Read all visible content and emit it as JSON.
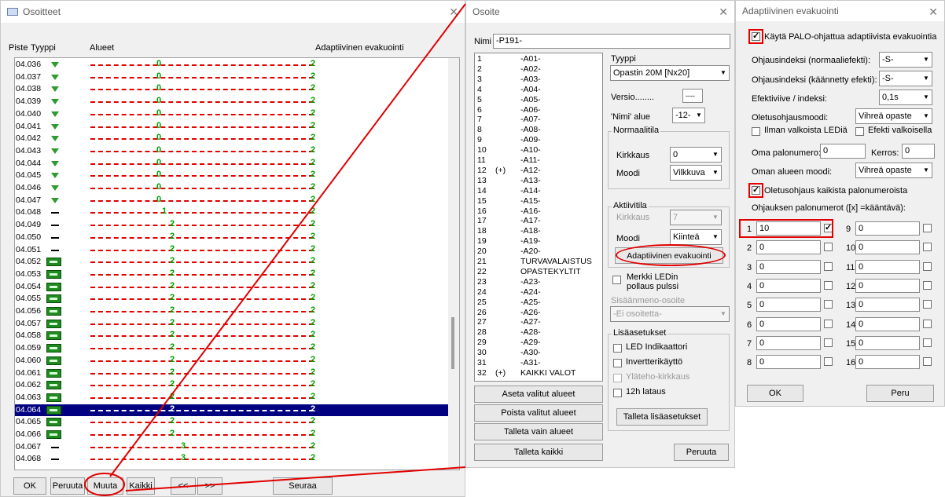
{
  "window1": {
    "title": "Osoitteet",
    "headers": {
      "piste": "Piste",
      "tyyppi": "Tyyppi",
      "alueet": "Alueet",
      "adaptive": "Adaptiivinen evakuointi"
    },
    "rows": [
      {
        "piste": "04.036",
        "type": "tri",
        "v1": "0",
        "v2": "2"
      },
      {
        "piste": "04.037",
        "type": "tri",
        "v1": "0",
        "v2": "2"
      },
      {
        "piste": "04.038",
        "type": "tri",
        "v1": "0",
        "v2": "2"
      },
      {
        "piste": "04.039",
        "type": "tri",
        "v1": "0",
        "v2": "2"
      },
      {
        "piste": "04.040",
        "type": "tri",
        "v1": "0",
        "v2": "2"
      },
      {
        "piste": "04.041",
        "type": "tri",
        "v1": "0",
        "v2": "2"
      },
      {
        "piste": "04.042",
        "type": "tri",
        "v1": "0",
        "v2": "2"
      },
      {
        "piste": "04.043",
        "type": "tri",
        "v1": "0",
        "v2": "2"
      },
      {
        "piste": "04.044",
        "type": "tri",
        "v1": "0",
        "v2": "2"
      },
      {
        "piste": "04.045",
        "type": "tri",
        "v1": "0",
        "v2": "2"
      },
      {
        "piste": "04.046",
        "type": "tri",
        "v1": "0",
        "v2": "2"
      },
      {
        "piste": "04.047",
        "type": "tri",
        "v1": "0",
        "v2": "2"
      },
      {
        "piste": "04.048",
        "type": "dash",
        "v1": "1",
        "v2": "2"
      },
      {
        "piste": "04.049",
        "type": "dash",
        "v1": "2",
        "v2": "2"
      },
      {
        "piste": "04.050",
        "type": "dash",
        "v1": "2",
        "v2": "2"
      },
      {
        "piste": "04.051",
        "type": "dash",
        "v1": "2",
        "v2": "2"
      },
      {
        "piste": "04.052",
        "type": "sign",
        "v1": "2",
        "v2": "2"
      },
      {
        "piste": "04.053",
        "type": "sign",
        "v1": "2",
        "v2": "2"
      },
      {
        "piste": "04.054",
        "type": "sign",
        "v1": "2",
        "v2": "2"
      },
      {
        "piste": "04.055",
        "type": "sign",
        "v1": "2",
        "v2": "2"
      },
      {
        "piste": "04.056",
        "type": "sign",
        "v1": "2",
        "v2": "2"
      },
      {
        "piste": "04.057",
        "type": "sign",
        "v1": "2",
        "v2": "2"
      },
      {
        "piste": "04.058",
        "type": "sign",
        "v1": "2",
        "v2": "2"
      },
      {
        "piste": "04.059",
        "type": "sign",
        "v1": "2",
        "v2": "2"
      },
      {
        "piste": "04.060",
        "type": "sign",
        "v1": "2",
        "v2": "2"
      },
      {
        "piste": "04.061",
        "type": "sign",
        "v1": "2",
        "v2": "2"
      },
      {
        "piste": "04.062",
        "type": "sign",
        "v1": "2",
        "v2": "2"
      },
      {
        "piste": "04.063",
        "type": "sign",
        "v1": "2",
        "v2": "2"
      },
      {
        "piste": "04.064",
        "type": "sign",
        "v1": "2",
        "v2": "2",
        "selected": true
      },
      {
        "piste": "04.065",
        "type": "sign",
        "v1": "2",
        "v2": "2"
      },
      {
        "piste": "04.066",
        "type": "sign",
        "v1": "2",
        "v2": "2"
      },
      {
        "piste": "04.067",
        "type": "dash",
        "v1": "3",
        "v2": "2"
      },
      {
        "piste": "04.068",
        "type": "dash",
        "v1": "3",
        "v2": "2"
      }
    ],
    "buttons": {
      "ok": "OK",
      "peruuta": "Peruuta",
      "muuta": "Muuta",
      "kaikki": "Kaikki",
      "prev": "<<",
      "next": ">>",
      "seuraa": "Seuraa"
    }
  },
  "window2": {
    "title": "Osoite",
    "nimi_label": "Nimi",
    "nimi_value": "-P191-",
    "zones": [
      {
        "n": "1",
        "f": "",
        "name": "-A01-"
      },
      {
        "n": "2",
        "f": "",
        "name": "-A02-"
      },
      {
        "n": "3",
        "f": "",
        "name": "-A03-"
      },
      {
        "n": "4",
        "f": "",
        "name": "-A04-"
      },
      {
        "n": "5",
        "f": "",
        "name": "-A05-"
      },
      {
        "n": "6",
        "f": "",
        "name": "-A06-"
      },
      {
        "n": "7",
        "f": "",
        "name": "-A07-"
      },
      {
        "n": "8",
        "f": "",
        "name": "-A08-"
      },
      {
        "n": "9",
        "f": "",
        "name": "-A09-"
      },
      {
        "n": "10",
        "f": "",
        "name": "-A10-"
      },
      {
        "n": "11",
        "f": "",
        "name": "-A11-"
      },
      {
        "n": "12",
        "f": "(+)",
        "name": "-A12-"
      },
      {
        "n": "13",
        "f": "",
        "name": "-A13-"
      },
      {
        "n": "14",
        "f": "",
        "name": "-A14-"
      },
      {
        "n": "15",
        "f": "",
        "name": "-A15-"
      },
      {
        "n": "16",
        "f": "",
        "name": "-A16-"
      },
      {
        "n": "17",
        "f": "",
        "name": "-A17-"
      },
      {
        "n": "18",
        "f": "",
        "name": "-A18-"
      },
      {
        "n": "19",
        "f": "",
        "name": "-A19-"
      },
      {
        "n": "20",
        "f": "",
        "name": "-A20-"
      },
      {
        "n": "21",
        "f": "",
        "name": "TURVAVALAISTUS"
      },
      {
        "n": "22",
        "f": "",
        "name": "OPASTEKYLTIT"
      },
      {
        "n": "23",
        "f": "",
        "name": "-A23-"
      },
      {
        "n": "24",
        "f": "",
        "name": "-A24-"
      },
      {
        "n": "25",
        "f": "",
        "name": "-A25-"
      },
      {
        "n": "26",
        "f": "",
        "name": "-A26-"
      },
      {
        "n": "27",
        "f": "",
        "name": "-A27-"
      },
      {
        "n": "28",
        "f": "",
        "name": "-A28-"
      },
      {
        "n": "29",
        "f": "",
        "name": "-A29-"
      },
      {
        "n": "30",
        "f": "",
        "name": "-A30-"
      },
      {
        "n": "31",
        "f": "",
        "name": "-A31-"
      },
      {
        "n": "32",
        "f": "(+)",
        "name": "KAIKKI VALOT"
      }
    ],
    "tyyppi_label": "Tyyppi",
    "tyyppi_value": "Opastin 20M [Nx20]",
    "versio_label": "Versio........",
    "versio_value": "----",
    "nimi_alue_label": "'Nimi' alue",
    "nimi_alue_value": "-12-",
    "normaalitila": {
      "title": "Normaalitila",
      "kirkkaus_label": "Kirkkaus",
      "kirkkaus_value": "0",
      "moodi_label": "Moodi",
      "moodi_value": "Vilkkuva"
    },
    "aktiivitila": {
      "title": "Aktiivitila",
      "kirkkaus_label": "Kirkkaus",
      "kirkkaus_value": "7",
      "moodi_label": "Moodi",
      "moodi_value": "Kiinteä",
      "adaptive_btn": "Adaptiivinen evakuointi"
    },
    "merkki": "Merkki LEDin pollaus pulssi",
    "sisaanmeno_label": "Sisäänmeno-osoite",
    "sisaanmeno_value": "-Ei osoitetta-",
    "lisa": {
      "title": "Lisäasetukset",
      "led": "LED Indikaattori",
      "invertteri": "Invertterikäyttö",
      "ylateho": "Yläteho-kirkkaus",
      "lataus": "12h lataus",
      "talleta_btn": "Talleta lisäasetukset"
    },
    "buttons": {
      "aseta": "Aseta valitut alueet",
      "poista": "Poista valitut alueet",
      "talleta_alueet": "Talleta vain alueet",
      "talleta_kaikki": "Talleta kaikki",
      "peruuta": "Peruuta"
    }
  },
  "window3": {
    "title": "Adaptiivinen evakuointi",
    "kayta": "Käytä PALO-ohjattua adaptiivista evakuointia",
    "ohj_norm_label": "Ohjausindeksi (normaaliefekti):",
    "ohj_norm_value": "-S-",
    "ohj_kaan_label": "Ohjausindeksi (käännetty efekti):",
    "ohj_kaan_value": "-S-",
    "efekti_label": "Efektiviive / indeksi:",
    "efekti_value": "0,1s",
    "oletus_label": "Oletusohjausmoodi:",
    "oletus_value": "Vihreä opaste",
    "ilman": "Ilman valkoista LEDiä",
    "efekti_valk": "Efekti valkoisella",
    "oma_label": "Oma palonumero:",
    "oma_value": "0",
    "kerros_label": "Kerros:",
    "kerros_value": "0",
    "oman_alueen_label": "Oman alueen moodi:",
    "oman_alueen_value": "Vihreä opaste",
    "oletusohjaus": "Oletusohjaus kaikista palonumeroista",
    "ohjauksen_label": "Ohjauksen palonumerot ([x] =kääntävä):",
    "numbers": [
      {
        "idx": "1",
        "val": "10",
        "checked": true
      },
      {
        "idx": "9",
        "val": "0",
        "checked": false
      },
      {
        "idx": "2",
        "val": "0",
        "checked": false
      },
      {
        "idx": "10",
        "val": "0",
        "checked": false
      },
      {
        "idx": "3",
        "val": "0",
        "checked": false
      },
      {
        "idx": "11",
        "val": "0",
        "checked": false
      },
      {
        "idx": "4",
        "val": "0",
        "checked": false
      },
      {
        "idx": "12",
        "val": "0",
        "checked": false
      },
      {
        "idx": "5",
        "val": "0",
        "checked": false
      },
      {
        "idx": "13",
        "val": "0",
        "checked": false
      },
      {
        "idx": "6",
        "val": "0",
        "checked": false
      },
      {
        "idx": "14",
        "val": "0",
        "checked": false
      },
      {
        "idx": "7",
        "val": "0",
        "checked": false
      },
      {
        "idx": "15",
        "val": "0",
        "checked": false
      },
      {
        "idx": "8",
        "val": "0",
        "checked": false
      },
      {
        "idx": "16",
        "val": "0",
        "checked": false
      }
    ],
    "ok": "OK",
    "peru": "Peru"
  },
  "colors": {
    "highlight": "#e00000",
    "selected_row": "#000080",
    "zone_line": "#e00000",
    "value_green": "#00a000"
  }
}
